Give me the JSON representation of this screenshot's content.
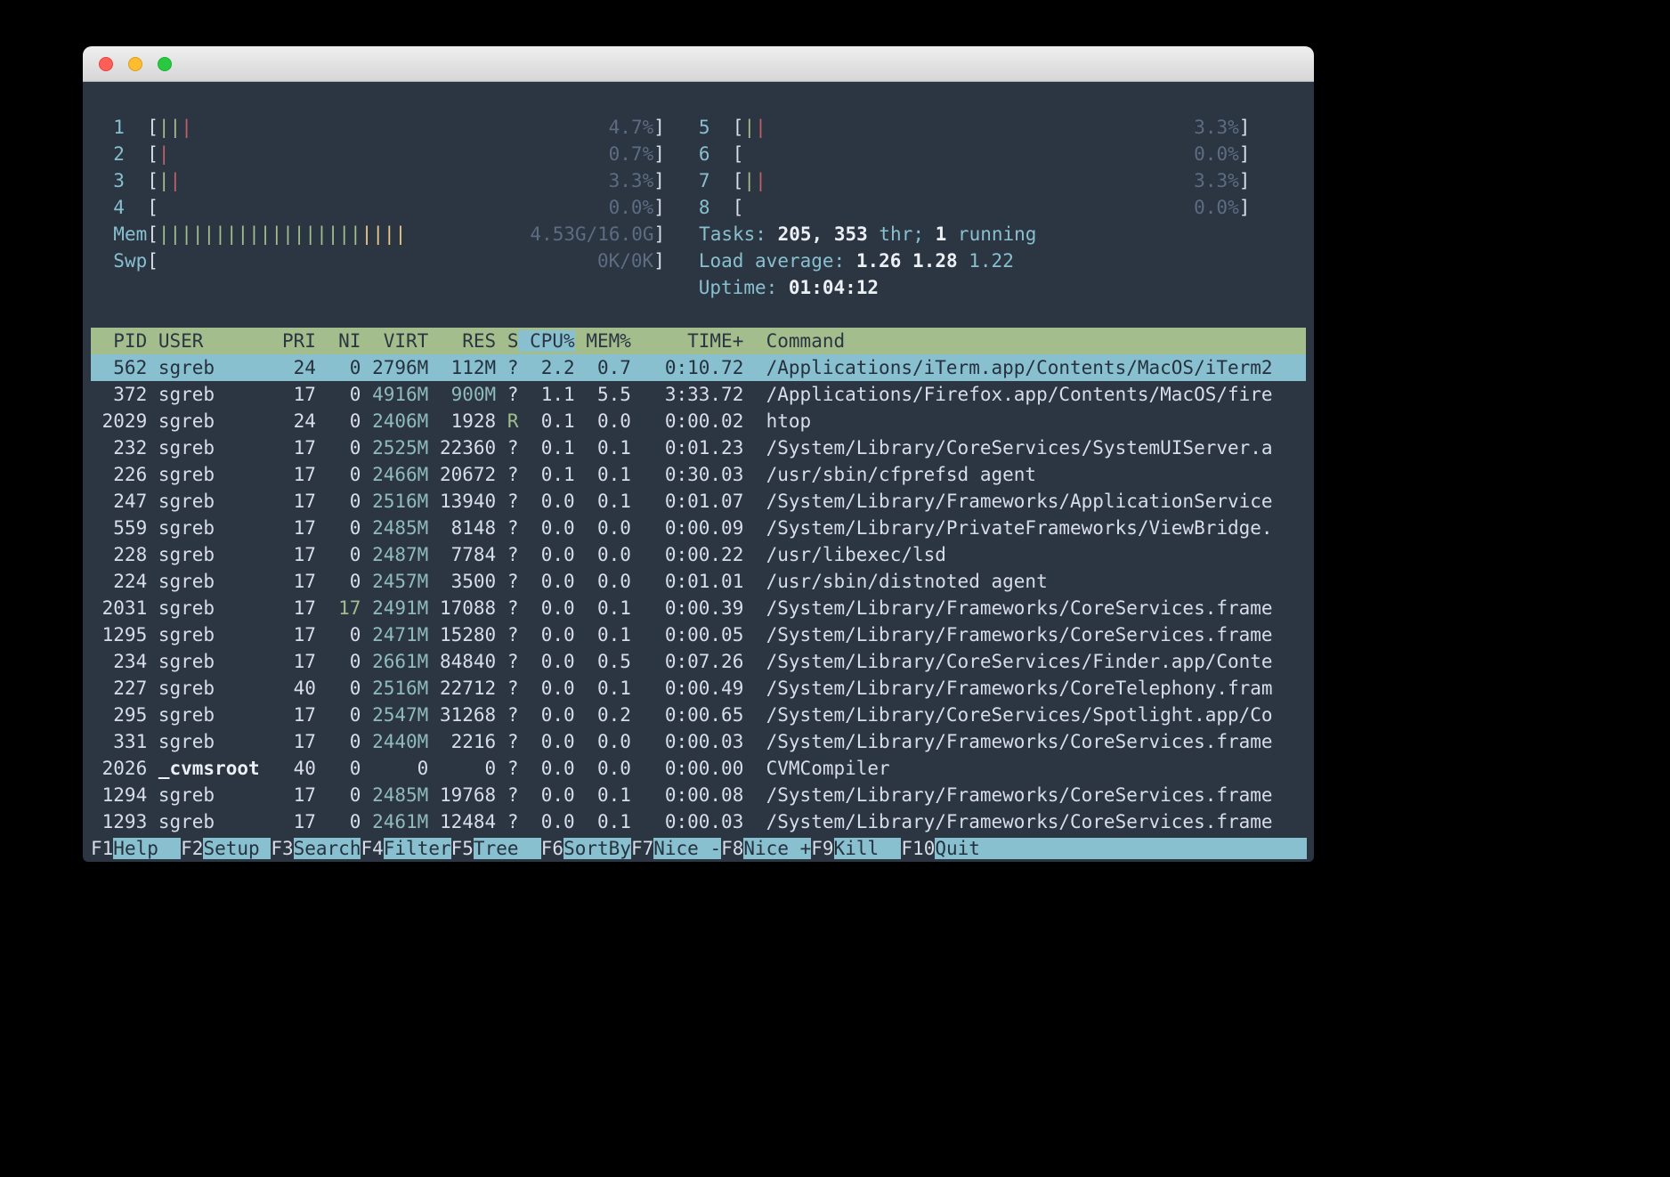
{
  "colors": {
    "terminal_bg": "#2c3542",
    "text": "#d8dee9",
    "cyan": "#88c0d0",
    "teal": "#8fbcbb",
    "green": "#a3be8c",
    "yellow": "#ebcb8b",
    "red": "#bf616a",
    "dim": "#5d6c82",
    "header_bg": "#a3be8c",
    "selection_bg": "#88c0d0"
  },
  "meters": {
    "left": [
      {
        "label": "1",
        "ticks": [
          "g",
          "g",
          "r"
        ],
        "text": "4.7%"
      },
      {
        "label": "2",
        "ticks": [
          "r"
        ],
        "text": "0.7%"
      },
      {
        "label": "3",
        "ticks": [
          "g",
          "r"
        ],
        "text": "3.3%"
      },
      {
        "label": "4",
        "ticks": [],
        "text": "0.0%"
      },
      {
        "label": "Mem",
        "ticks": [
          "g",
          "g",
          "g",
          "g",
          "g",
          "g",
          "g",
          "g",
          "g",
          "g",
          "g",
          "g",
          "g",
          "g",
          "g",
          "g",
          "g",
          "g",
          "y",
          "y",
          "y",
          "y"
        ],
        "text": "4.53G/16.0G"
      },
      {
        "label": "Swp",
        "ticks": [],
        "text": "0K/0K"
      }
    ],
    "right": [
      {
        "label": "5",
        "ticks": [
          "g",
          "r"
        ],
        "text": "3.3%"
      },
      {
        "label": "6",
        "ticks": [],
        "text": "0.0%"
      },
      {
        "label": "7",
        "ticks": [
          "g",
          "r"
        ],
        "text": "3.3%"
      },
      {
        "label": "8",
        "ticks": [],
        "text": "0.0%"
      }
    ]
  },
  "stats": {
    "tasks": [
      {
        "t": "Tasks: ",
        "c": "cyan"
      },
      {
        "t": "205, 353",
        "c": "bold"
      },
      {
        "t": " thr; ",
        "c": "cyan"
      },
      {
        "t": "1",
        "c": "bold"
      },
      {
        "t": " running",
        "c": "cyan"
      }
    ],
    "load": [
      {
        "t": "Load average: ",
        "c": "cyan"
      },
      {
        "t": "1.26 ",
        "c": "bold"
      },
      {
        "t": "1.28 ",
        "c": "bold"
      },
      {
        "t": "1.22",
        "c": "cyan"
      }
    ],
    "uptime": [
      {
        "t": "Uptime: ",
        "c": "cyan"
      },
      {
        "t": "01:04:12",
        "c": "bold"
      }
    ]
  },
  "table": {
    "columns": [
      "PID",
      "USER",
      "PRI",
      "NI",
      "VIRT",
      "RES",
      "S",
      "CPU%",
      "MEM%",
      "TIME+",
      "Command"
    ],
    "sort_column": "CPU%",
    "sort_index": 7,
    "selected_row": 0,
    "rows": [
      [
        "562",
        "sgreb",
        "24",
        "0",
        "2796M",
        "112M",
        "?",
        "2.2",
        "0.7",
        "0:10.72",
        "/Applications/iTerm.app/Contents/MacOS/iTerm2"
      ],
      [
        "372",
        "sgreb",
        "17",
        "0",
        "4916M",
        "900M",
        "?",
        "1.1",
        "5.5",
        "3:33.72",
        "/Applications/Firefox.app/Contents/MacOS/fire"
      ],
      [
        "2029",
        "sgreb",
        "24",
        "0",
        "2406M",
        "1928",
        "R",
        "0.1",
        "0.0",
        "0:00.02",
        "htop"
      ],
      [
        "232",
        "sgreb",
        "17",
        "0",
        "2525M",
        "22360",
        "?",
        "0.1",
        "0.1",
        "0:01.23",
        "/System/Library/CoreServices/SystemUIServer.a"
      ],
      [
        "226",
        "sgreb",
        "17",
        "0",
        "2466M",
        "20672",
        "?",
        "0.1",
        "0.1",
        "0:30.03",
        "/usr/sbin/cfprefsd agent"
      ],
      [
        "247",
        "sgreb",
        "17",
        "0",
        "2516M",
        "13940",
        "?",
        "0.0",
        "0.1",
        "0:01.07",
        "/System/Library/Frameworks/ApplicationService"
      ],
      [
        "559",
        "sgreb",
        "17",
        "0",
        "2485M",
        "8148",
        "?",
        "0.0",
        "0.0",
        "0:00.09",
        "/System/Library/PrivateFrameworks/ViewBridge."
      ],
      [
        "228",
        "sgreb",
        "17",
        "0",
        "2487M",
        "7784",
        "?",
        "0.0",
        "0.0",
        "0:00.22",
        "/usr/libexec/lsd"
      ],
      [
        "224",
        "sgreb",
        "17",
        "0",
        "2457M",
        "3500",
        "?",
        "0.0",
        "0.0",
        "0:01.01",
        "/usr/sbin/distnoted agent"
      ],
      [
        "2031",
        "sgreb",
        "17",
        "17",
        "2491M",
        "17088",
        "?",
        "0.0",
        "0.1",
        "0:00.39",
        "/System/Library/Frameworks/CoreServices.frame"
      ],
      [
        "1295",
        "sgreb",
        "17",
        "0",
        "2471M",
        "15280",
        "?",
        "0.0",
        "0.1",
        "0:00.05",
        "/System/Library/Frameworks/CoreServices.frame"
      ],
      [
        "234",
        "sgreb",
        "17",
        "0",
        "2661M",
        "84840",
        "?",
        "0.0",
        "0.5",
        "0:07.26",
        "/System/Library/CoreServices/Finder.app/Conte"
      ],
      [
        "227",
        "sgreb",
        "40",
        "0",
        "2516M",
        "22712",
        "?",
        "0.0",
        "0.1",
        "0:00.49",
        "/System/Library/Frameworks/CoreTelephony.fram"
      ],
      [
        "295",
        "sgreb",
        "17",
        "0",
        "2547M",
        "31268",
        "?",
        "0.0",
        "0.2",
        "0:00.65",
        "/System/Library/CoreServices/Spotlight.app/Co"
      ],
      [
        "331",
        "sgreb",
        "17",
        "0",
        "2440M",
        "2216",
        "?",
        "0.0",
        "0.0",
        "0:00.03",
        "/System/Library/Frameworks/CoreServices.frame"
      ],
      [
        "2026",
        "_cvmsroot",
        "40",
        "0",
        "0",
        "0",
        "?",
        "0.0",
        "0.0",
        "0:00.00",
        "CVMCompiler"
      ],
      [
        "1294",
        "sgreb",
        "17",
        "0",
        "2485M",
        "19768",
        "?",
        "0.0",
        "0.1",
        "0:00.08",
        "/System/Library/Frameworks/CoreServices.frame"
      ],
      [
        "1293",
        "sgreb",
        "17",
        "0",
        "2461M",
        "12484",
        "?",
        "0.0",
        "0.1",
        "0:00.03",
        "/System/Library/Frameworks/CoreServices.frame"
      ]
    ]
  },
  "fkeys": [
    {
      "key": "F1",
      "label": "Help"
    },
    {
      "key": "F2",
      "label": "Setup"
    },
    {
      "key": "F3",
      "label": "Search"
    },
    {
      "key": "F4",
      "label": "Filter"
    },
    {
      "key": "F5",
      "label": "Tree"
    },
    {
      "key": "F6",
      "label": "SortBy"
    },
    {
      "key": "F7",
      "label": "Nice -"
    },
    {
      "key": "F8",
      "label": "Nice +"
    },
    {
      "key": "F9",
      "label": "Kill"
    },
    {
      "key": "F10",
      "label": "Quit"
    }
  ]
}
